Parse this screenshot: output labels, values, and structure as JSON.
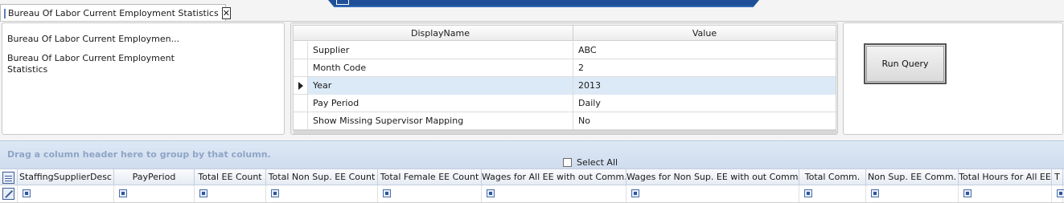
{
  "tab": {
    "title": "Bureau Of Labor Current Employment Statistics",
    "icon": "grid-icon",
    "close_icon": "close-icon"
  },
  "report_list": {
    "truncated_title": "Bureau Of Labor Current Employmen...",
    "full_title": "Bureau Of Labor Current Employment Statistics"
  },
  "parameters": {
    "columns": [
      "DisplayName",
      "Value"
    ],
    "selected_index": 2,
    "rows": [
      {
        "name": "Supplier",
        "value": "ABC"
      },
      {
        "name": "Month Code",
        "value": "2"
      },
      {
        "name": "Year",
        "value": "2013"
      },
      {
        "name": "Pay Period",
        "value": "Daily"
      },
      {
        "name": "Show Missing Supervisor Mapping",
        "value": "No"
      }
    ]
  },
  "actions": {
    "run_query_label": "Run Query"
  },
  "grid": {
    "group_hint": "Drag a column header here to group by that column.",
    "select_all_label": "Select All",
    "select_all_checked": false,
    "columns": [
      "StaffingSupplierDesc",
      "PayPeriod",
      "Total EE Count",
      "Total Non Sup. EE Count",
      "Total Female EE Count",
      "Wages for All EE with out Comm.",
      "Wages for Non Sup. EE with out Comm.",
      "Total Comm.",
      "Non Sup. EE Comm.",
      "Total Hours for All EE",
      "T"
    ]
  },
  "colors": {
    "accent": "#1f4f98",
    "selected_row": "#dceaf7",
    "group_hint": "#8ea5c6"
  }
}
